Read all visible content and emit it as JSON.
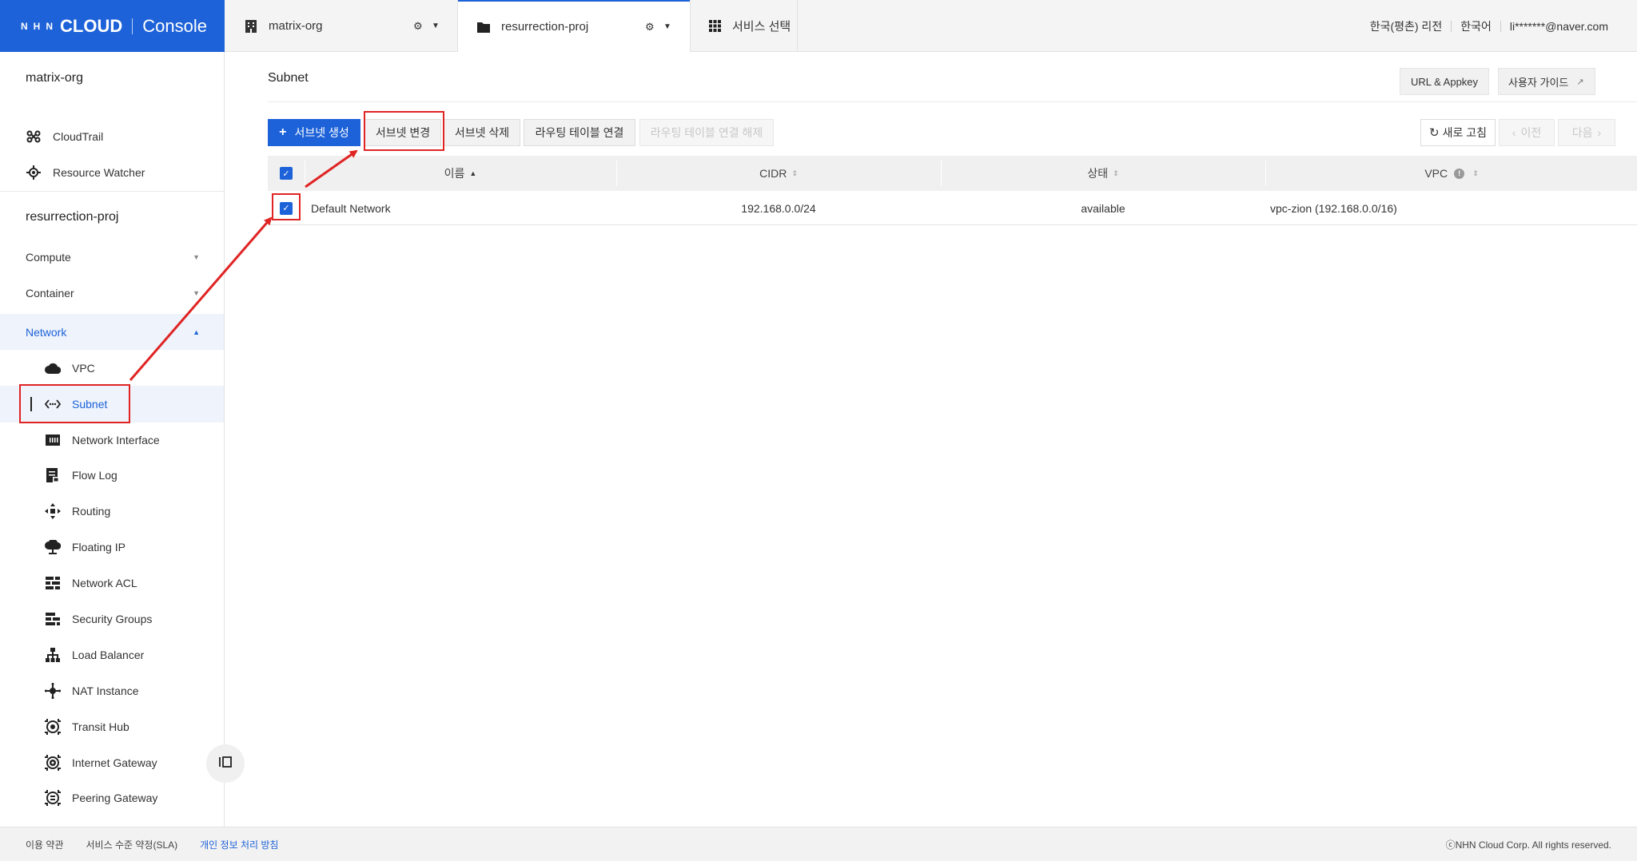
{
  "topbar": {
    "logo_brand": "NHN",
    "logo_cloud": "CLOUD",
    "logo_console": "Console",
    "org_tab": "matrix-org",
    "project_tab": "resurrection-proj",
    "service_tab": "서비스 선택",
    "region": "한국(평촌) 리전",
    "language": "한국어",
    "user_email": "li*******@naver.com"
  },
  "sidebar": {
    "org_title": "matrix-org",
    "org_items": [
      {
        "label": "CloudTrail",
        "icon": "cloudtrail-icon"
      },
      {
        "label": "Resource Watcher",
        "icon": "resource-watcher-icon"
      }
    ],
    "project_title": "resurrection-proj",
    "categories": [
      {
        "label": "Compute"
      },
      {
        "label": "Container"
      },
      {
        "label": "Network"
      }
    ],
    "network_items": [
      {
        "label": "VPC",
        "icon": "cloud-icon"
      },
      {
        "label": "Subnet",
        "icon": "subnet-arrows-icon"
      },
      {
        "label": "Network Interface",
        "icon": "network-interface-icon"
      },
      {
        "label": "Flow Log",
        "icon": "flow-log-icon"
      },
      {
        "label": "Routing",
        "icon": "routing-icon"
      },
      {
        "label": "Floating IP",
        "icon": "floating-ip-icon"
      },
      {
        "label": "Network ACL",
        "icon": "network-acl-icon"
      },
      {
        "label": "Security Groups",
        "icon": "security-groups-icon"
      },
      {
        "label": "Load Balancer",
        "icon": "load-balancer-icon"
      },
      {
        "label": "NAT Instance",
        "icon": "nat-instance-icon"
      },
      {
        "label": "Transit Hub",
        "icon": "transit-hub-icon"
      },
      {
        "label": "Internet Gateway",
        "icon": "internet-gateway-icon"
      },
      {
        "label": "Peering Gateway",
        "icon": "peering-gateway-icon"
      }
    ]
  },
  "main": {
    "page_title": "Subnet",
    "url_appkey": "URL & Appkey",
    "user_guide": "사용자 가이드",
    "toolbar": {
      "create": "서브넷 생성",
      "modify": "서브넷 변경",
      "delete": "서브넷 삭제",
      "attach_routing": "라우팅 테이블 연결",
      "detach_routing": "라우팅 테이블 연결 해제",
      "refresh": "새로 고침",
      "prev": "이전",
      "next": "다음"
    },
    "table": {
      "columns": [
        "이름",
        "CIDR",
        "상태",
        "VPC"
      ],
      "rows": [
        {
          "name": "Default Network",
          "cidr": "192.168.0.0/24",
          "status": "available",
          "vpc": "vpc-zion (192.168.0.0/16)"
        }
      ]
    }
  },
  "footer": {
    "terms": "이용 약관",
    "sla": "서비스 수준 약정(SLA)",
    "privacy": "개인 정보 처리 방침",
    "copyright": "ⓒNHN Cloud Corp. All rights reserved."
  },
  "colors": {
    "brand_blue": "#1d62d8",
    "annotation_red": "#e02424"
  }
}
